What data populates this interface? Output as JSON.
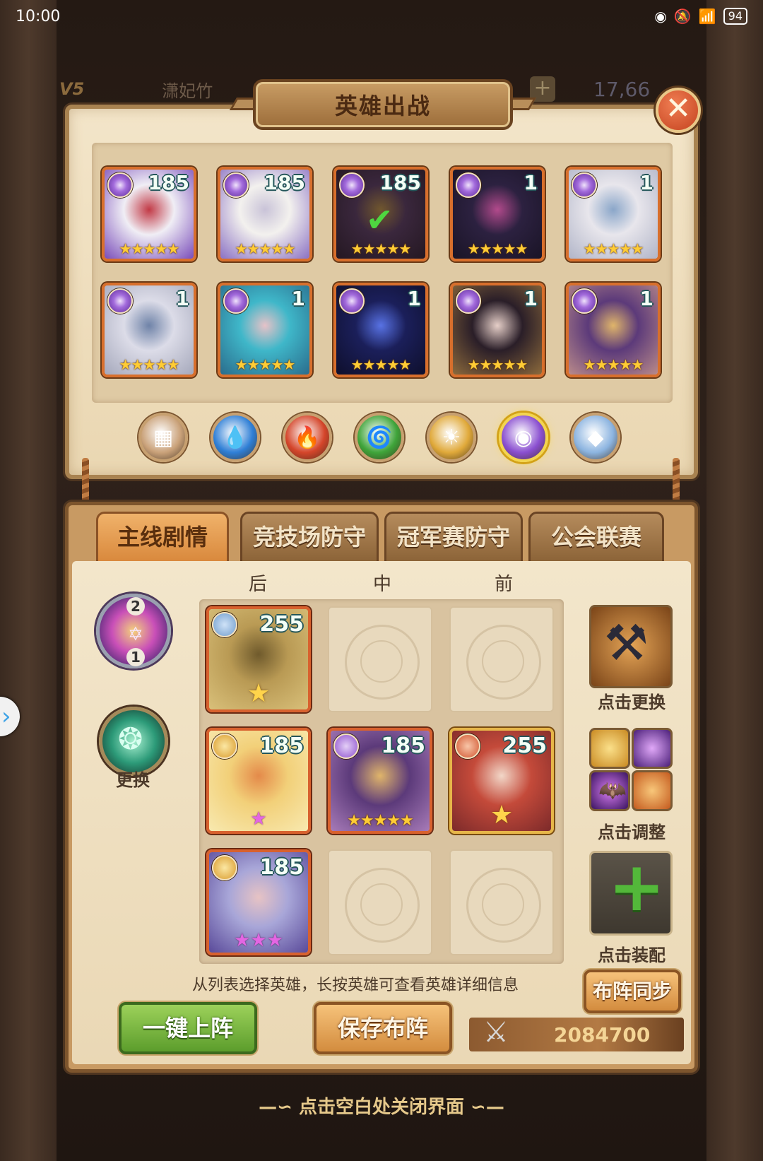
{
  "status_bar": {
    "time": "10:00",
    "battery": "94"
  },
  "behind": {
    "vip": "V5",
    "player_name": "潇妃竹",
    "gems": "17,66",
    "plus": "+"
  },
  "header": {
    "title": "英雄出战",
    "close": "✕"
  },
  "hero_list": [
    {
      "level": "185",
      "stars": "★★★★★",
      "element": "dark",
      "palette": [
        "#f0eef5",
        "#c23a46",
        "#7a4dba"
      ],
      "selected": false
    },
    {
      "level": "185",
      "stars": "★★★★★",
      "element": "dark",
      "palette": [
        "#f3f1ee",
        "#c9c3d8",
        "#8a71c4"
      ],
      "selected": false
    },
    {
      "level": "185",
      "stars": "★★★★★",
      "element": "dark",
      "palette": [
        "#5e3f7c",
        "#d6a95c",
        "#2e1d40"
      ],
      "selected": true,
      "check": "✔"
    },
    {
      "level": "1",
      "stars": "★★★★★",
      "element": "dark",
      "palette": [
        "#2c2140",
        "#b24a8c",
        "#1a1426"
      ],
      "selected": false
    },
    {
      "level": "1",
      "stars": "★★★★★",
      "element": "dark",
      "palette": [
        "#e8e6ec",
        "#8aa6c9",
        "#b1b5c8"
      ],
      "selected": false
    },
    {
      "level": "1",
      "stars": "★★★★★",
      "element": "dark",
      "palette": [
        "#dcdce8",
        "#6f83a8",
        "#a5a8bb"
      ],
      "selected": false
    },
    {
      "level": "1",
      "stars": "★★★★★",
      "element": "dark",
      "palette": [
        "#3fb7c9",
        "#e6c2c8",
        "#2a6c8c"
      ],
      "selected": false
    },
    {
      "level": "1",
      "stars": "★★★★★",
      "element": "dark",
      "palette": [
        "#1b1f5a",
        "#5872e4",
        "#0e0f2c"
      ],
      "selected": false
    },
    {
      "level": "1",
      "stars": "★★★★★",
      "element": "dark",
      "palette": [
        "#2a1e28",
        "#e6cfc8",
        "#8c6a3c"
      ],
      "selected": false
    },
    {
      "level": "1",
      "stars": "★★★★★",
      "element": "dark",
      "palette": [
        "#5c3a7a",
        "#e0b56a",
        "#b98a8a"
      ],
      "selected": false
    }
  ],
  "filters": [
    {
      "name": "all",
      "glyph": "▦",
      "bg": "#caa27a",
      "active": false
    },
    {
      "name": "water",
      "glyph": "💧",
      "bg": "#2f7fd6",
      "active": false
    },
    {
      "name": "fire",
      "glyph": "🔥",
      "bg": "#d4452a",
      "active": false
    },
    {
      "name": "wind",
      "glyph": "🌀",
      "bg": "#3fa43a",
      "active": false
    },
    {
      "name": "light",
      "glyph": "☀",
      "bg": "#e0a93a",
      "active": false
    },
    {
      "name": "dark",
      "glyph": "◉",
      "bg": "#8a4fd0",
      "active": true
    },
    {
      "name": "void",
      "glyph": "◆",
      "bg": "#8cb4e0",
      "active": false
    }
  ],
  "tabs": [
    {
      "label": "主线剧情",
      "active": true
    },
    {
      "label": "竞技场防守",
      "active": false
    },
    {
      "label": "冠军赛防守",
      "active": false
    },
    {
      "label": "公会联赛",
      "active": false
    }
  ],
  "columns": [
    "后",
    "中",
    "前"
  ],
  "formation": {
    "r1c1": {
      "level": "255",
      "stars": "★",
      "palette": [
        "#b99a54",
        "#6f5a2c",
        "#d9c07a"
      ]
    },
    "r2c1": {
      "level": "185",
      "stars": "★",
      "palette": [
        "#f2d079",
        "#e48a4a",
        "#f8e9b0"
      ]
    },
    "r2c2": {
      "level": "185",
      "stars": "★★★★★",
      "palette": [
        "#5c3a7a",
        "#e0b56a",
        "#a77bb8"
      ]
    },
    "r2c3": {
      "level": "255",
      "stars": "★",
      "palette": [
        "#c44a3a",
        "#f2d7c8",
        "#7c2a2a"
      ]
    },
    "r3c1": {
      "level": "185",
      "stars": "★★★",
      "palette": [
        "#a8a6d8",
        "#e7c3c4",
        "#5a4a9a"
      ]
    }
  },
  "left_side": {
    "orb_top": "2",
    "orb_bottom": "1",
    "swap_label": "更换"
  },
  "right_side": {
    "change_label": "点击更换",
    "adjust_label": "点击调整",
    "equip_label": "点击装配",
    "equip_plus": "+"
  },
  "hint": "从列表选择英雄，长按英雄可查看英雄详细信息",
  "sync_button": "布阵同步",
  "one_click_button": "一键上阵",
  "save_button": "保存布阵",
  "power": "2084700",
  "close_hint": "—∽ 点击空白处关闭界面 ∽—"
}
